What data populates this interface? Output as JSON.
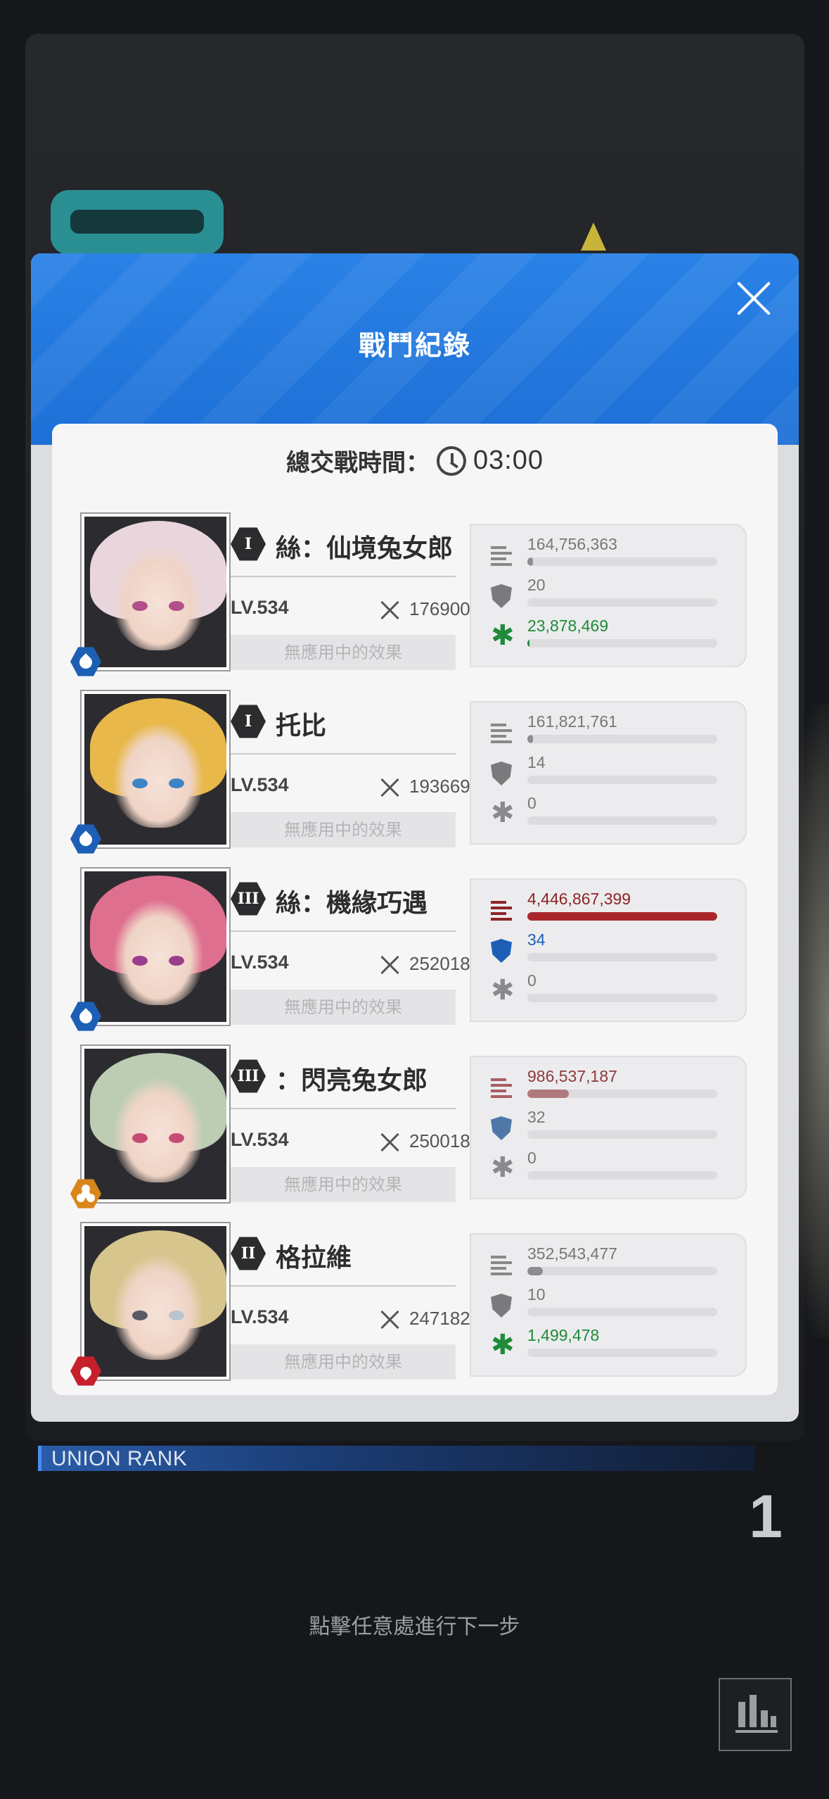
{
  "modal": {
    "title": "戰鬥紀錄",
    "total_time_label": "總交戰時間：",
    "total_time": "03:00"
  },
  "characters": [
    {
      "burst": "I",
      "name": "絲：仙境兔女郎",
      "level": "LV.534",
      "power": "176900",
      "effect": "無應用中的效果",
      "element": "water",
      "damage": "164,756,363",
      "damage_ratio": 0.03,
      "hits_taken": "20",
      "hits_ratio": 0.0,
      "healing": "23,878,469",
      "healing_ratio": 0.01
    },
    {
      "burst": "I",
      "name": "托比",
      "level": "LV.534",
      "power": "193669",
      "effect": "無應用中的效果",
      "element": "water",
      "damage": "161,821,761",
      "damage_ratio": 0.03,
      "hits_taken": "14",
      "hits_ratio": 0.0,
      "healing": "0",
      "healing_ratio": 0.0
    },
    {
      "burst": "III",
      "name": "絲：機緣巧遇",
      "level": "LV.534",
      "power": "252018",
      "effect": "無應用中的效果",
      "element": "water",
      "damage": "4,446,867,399",
      "damage_ratio": 1.0,
      "hits_taken": "34",
      "hits_ratio": 0.0,
      "healing": "0",
      "healing_ratio": 0.0
    },
    {
      "burst": "III",
      "name": "：閃亮兔女郎",
      "level": "LV.534",
      "power": "250018",
      "effect": "無應用中的效果",
      "element": "iron",
      "damage": "986,537,187",
      "damage_ratio": 0.22,
      "hits_taken": "32",
      "hits_ratio": 0.0,
      "healing": "0",
      "healing_ratio": 0.0
    },
    {
      "burst": "II",
      "name": "格拉維",
      "level": "LV.534",
      "power": "247182",
      "effect": "無應用中的效果",
      "element": "fire",
      "damage": "352,543,477",
      "damage_ratio": 0.08,
      "hits_taken": "10",
      "hits_ratio": 0.0,
      "healing": "1,499,478",
      "healing_ratio": 0.0
    }
  ],
  "background": {
    "union_rank_label": "UNION RANK",
    "rank_value": "1",
    "hint": "點擊任意處進行下一步"
  },
  "colors": {
    "header_blue": "#1c6fd6",
    "top_damage_red": "#8e2326",
    "healing_green": "#1f8a3a",
    "defense_blue": "#1c5fb5"
  },
  "icons": {
    "close": "close-icon",
    "clock": "clock-icon",
    "damage": "damage-bars-icon",
    "defense": "shield-icon",
    "healing": "heal-star-icon",
    "power": "crossed-swords-icon",
    "stats": "bar-chart-icon"
  }
}
